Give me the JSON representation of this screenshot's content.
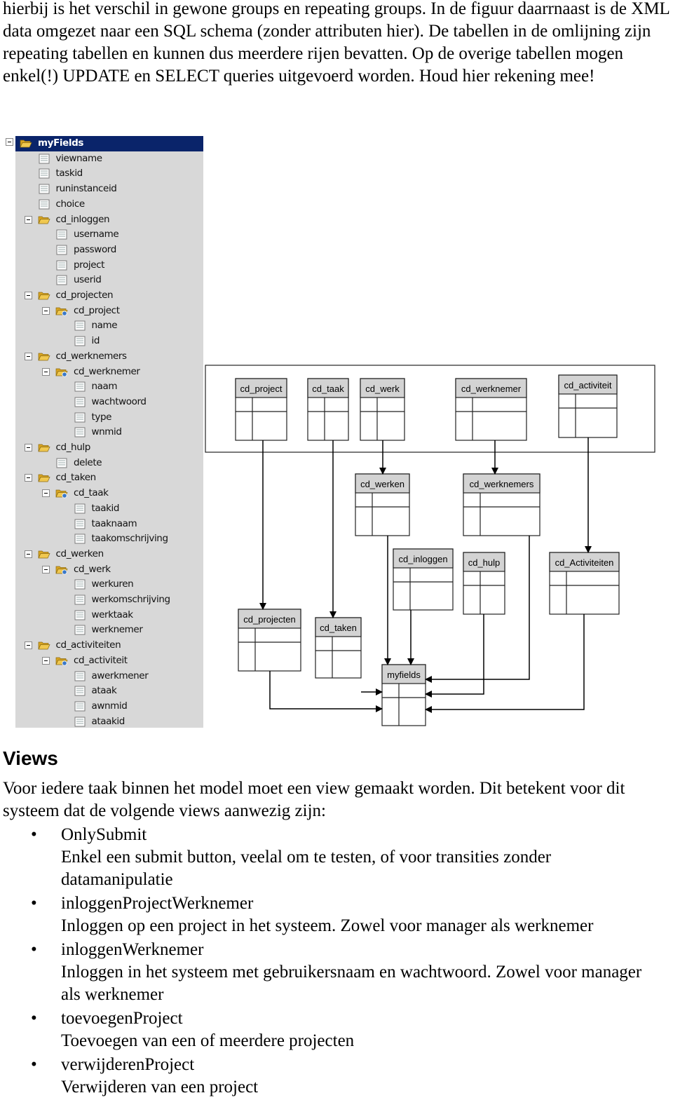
{
  "intro_text": "hierbij is het verschil in gewone groups en repeating groups. In de figuur daarrnaast is de XML data omgezet naar een SQL schema (zonder attributen hier). De tabellen in de omlijning zijn repeating tabellen en kunnen dus meerdere rijen bevatten. Op de overige tabellen mogen enkel(!) UPDATE en SELECT queries uitgevoerd worden. Houd hier rekening mee!",
  "tree": {
    "colors": {
      "background": "#d8d8d8",
      "selected": "#0a246a",
      "folder": "#f0c850"
    },
    "items": [
      {
        "label": "myFields",
        "level": 0,
        "type": "folder"
      },
      {
        "label": "viewname",
        "level": 1,
        "type": "field"
      },
      {
        "label": "taskid",
        "level": 1,
        "type": "field"
      },
      {
        "label": "runinstanceid",
        "level": 1,
        "type": "field"
      },
      {
        "label": "choice",
        "level": 1,
        "type": "field"
      },
      {
        "label": "cd_inloggen",
        "level": 1,
        "type": "folder"
      },
      {
        "label": "username",
        "level": 2,
        "type": "field"
      },
      {
        "label": "password",
        "level": 2,
        "type": "field"
      },
      {
        "label": "project",
        "level": 2,
        "type": "field"
      },
      {
        "label": "userid",
        "level": 2,
        "type": "field"
      },
      {
        "label": "cd_projecten",
        "level": 1,
        "type": "folder"
      },
      {
        "label": "cd_project",
        "level": 2,
        "type": "repeating"
      },
      {
        "label": "name",
        "level": 3,
        "type": "field"
      },
      {
        "label": "id",
        "level": 3,
        "type": "field"
      },
      {
        "label": "cd_werknemers",
        "level": 1,
        "type": "folder"
      },
      {
        "label": "cd_werknemer",
        "level": 2,
        "type": "repeating"
      },
      {
        "label": "naam",
        "level": 3,
        "type": "field"
      },
      {
        "label": "wachtwoord",
        "level": 3,
        "type": "field"
      },
      {
        "label": "type",
        "level": 3,
        "type": "field"
      },
      {
        "label": "wnmid",
        "level": 3,
        "type": "field"
      },
      {
        "label": "cd_hulp",
        "level": 1,
        "type": "folder"
      },
      {
        "label": "delete",
        "level": 2,
        "type": "field"
      },
      {
        "label": "cd_taken",
        "level": 1,
        "type": "folder"
      },
      {
        "label": "cd_taak",
        "level": 2,
        "type": "repeating"
      },
      {
        "label": "taakid",
        "level": 3,
        "type": "field"
      },
      {
        "label": "taaknaam",
        "level": 3,
        "type": "field"
      },
      {
        "label": "taakomschrijving",
        "level": 3,
        "type": "field"
      },
      {
        "label": "cd_werken",
        "level": 1,
        "type": "folder"
      },
      {
        "label": "cd_werk",
        "level": 2,
        "type": "repeating"
      },
      {
        "label": "werkuren",
        "level": 3,
        "type": "field"
      },
      {
        "label": "werkomschrijving",
        "level": 3,
        "type": "field"
      },
      {
        "label": "werktaak",
        "level": 3,
        "type": "field"
      },
      {
        "label": "werknemer",
        "level": 3,
        "type": "field"
      },
      {
        "label": "cd_activiteiten",
        "level": 1,
        "type": "folder"
      },
      {
        "label": "cd_activiteit",
        "level": 2,
        "type": "repeating"
      },
      {
        "label": "awerkmener",
        "level": 3,
        "type": "field"
      },
      {
        "label": "ataak",
        "level": 3,
        "type": "field"
      },
      {
        "label": "awnmid",
        "level": 3,
        "type": "field"
      },
      {
        "label": "ataakid",
        "level": 3,
        "type": "field"
      }
    ]
  },
  "diagram": {
    "header_color": "#d3d3d3",
    "tables": [
      {
        "id": "cd_project",
        "label": "cd_project",
        "repeating": true
      },
      {
        "id": "cd_taak",
        "label": "cd_taak",
        "repeating": true
      },
      {
        "id": "cd_werk",
        "label": "cd_werk",
        "repeating": true
      },
      {
        "id": "cd_werknemer",
        "label": "cd_werknemer",
        "repeating": true
      },
      {
        "id": "cd_activiteit",
        "label": "cd_activiteit",
        "repeating": true
      },
      {
        "id": "cd_werken",
        "label": "cd_werken",
        "repeating": false
      },
      {
        "id": "cd_werknemers",
        "label": "cd_werknemers",
        "repeating": false
      },
      {
        "id": "cd_inloggen",
        "label": "cd_inloggen",
        "repeating": false
      },
      {
        "id": "cd_hulp",
        "label": "cd_hulp",
        "repeating": false
      },
      {
        "id": "cd_Activiteiten",
        "label": "cd_Activiteiten",
        "repeating": false
      },
      {
        "id": "cd_projecten",
        "label": "cd_projecten",
        "repeating": false
      },
      {
        "id": "cd_taken",
        "label": "cd_taken",
        "repeating": false
      },
      {
        "id": "myfields",
        "label": "myfields",
        "repeating": false
      }
    ],
    "relations": [
      {
        "from": "cd_project",
        "to": "cd_projecten"
      },
      {
        "from": "cd_taak",
        "to": "cd_taken"
      },
      {
        "from": "cd_werk",
        "to": "cd_werken"
      },
      {
        "from": "cd_werknemer",
        "to": "cd_werknemers"
      },
      {
        "from": "cd_activiteit",
        "to": "cd_Activiteiten"
      },
      {
        "from": "cd_werken",
        "to": "myfields"
      },
      {
        "from": "cd_inloggen",
        "to": "myfields"
      },
      {
        "from": "cd_taken",
        "to": "myfields"
      },
      {
        "from": "cd_projecten",
        "to": "myfields"
      },
      {
        "from": "cd_werknemers",
        "to": "myfields"
      },
      {
        "from": "cd_hulp",
        "to": "myfields"
      },
      {
        "from": "cd_Activiteiten",
        "to": "myfields"
      }
    ]
  },
  "views": {
    "title": "Views",
    "intro": "Voor iedere taak binnen het model moet een view gemaakt worden. Dit betekent voor dit systeem dat de volgende views aanwezig zijn:",
    "bullet": "•",
    "items": [
      {
        "name": "OnlySubmit",
        "description": "Enkel een submit button, veelal om te testen, of voor transities zonder datamanipulatie"
      },
      {
        "name": "inloggenProjectWerknemer",
        "description": "Inloggen op een project in het systeem. Zowel voor manager als werknemer"
      },
      {
        "name": "inloggenWerknemer",
        "description": "Inloggen in het systeem met gebruikersnaam en wachtwoord. Zowel voor manager als werknemer"
      },
      {
        "name": "toevoegenProject",
        "description": "Toevoegen van een of meerdere projecten"
      },
      {
        "name": "verwijderenProject",
        "description": "Verwijderen van een project"
      }
    ]
  }
}
